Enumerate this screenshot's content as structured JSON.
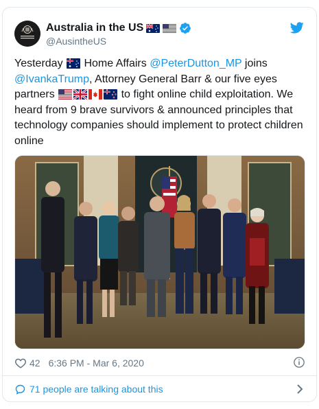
{
  "account": {
    "display_name": "Australia in the US",
    "handle": "@AusintheUS",
    "avatar_caption_line1": "Embassy of Australia",
    "avatar_caption_line2": "United States of America"
  },
  "tweet": {
    "t1": "Yesterday ",
    "t2": " Home Affairs ",
    "mention1": "@PeterDutton_MP",
    "t3": " joins ",
    "mention2": "@IvankaTrump",
    "t4": ", Attorney General Barr & our five eyes partners ",
    "t5": " to fight online child exploitation. We heard from 9 brave survivors & announced principles that technology companies should implement to protect children online"
  },
  "meta": {
    "like_count": "42",
    "timestamp": "6:36 PM - Mar 6, 2020"
  },
  "footer": {
    "talking_label": "71 people are talking about this"
  },
  "icons": {
    "verified": "verified-badge-icon",
    "bird": "twitter-bird-icon",
    "heart": "heart-icon",
    "info": "info-icon",
    "bubble": "speech-bubble-icon",
    "chevron": "chevron-right-icon"
  },
  "colors": {
    "link": "#1b95e0",
    "muted": "#657786",
    "border": "#e1e8ed",
    "text": "#14171a"
  }
}
